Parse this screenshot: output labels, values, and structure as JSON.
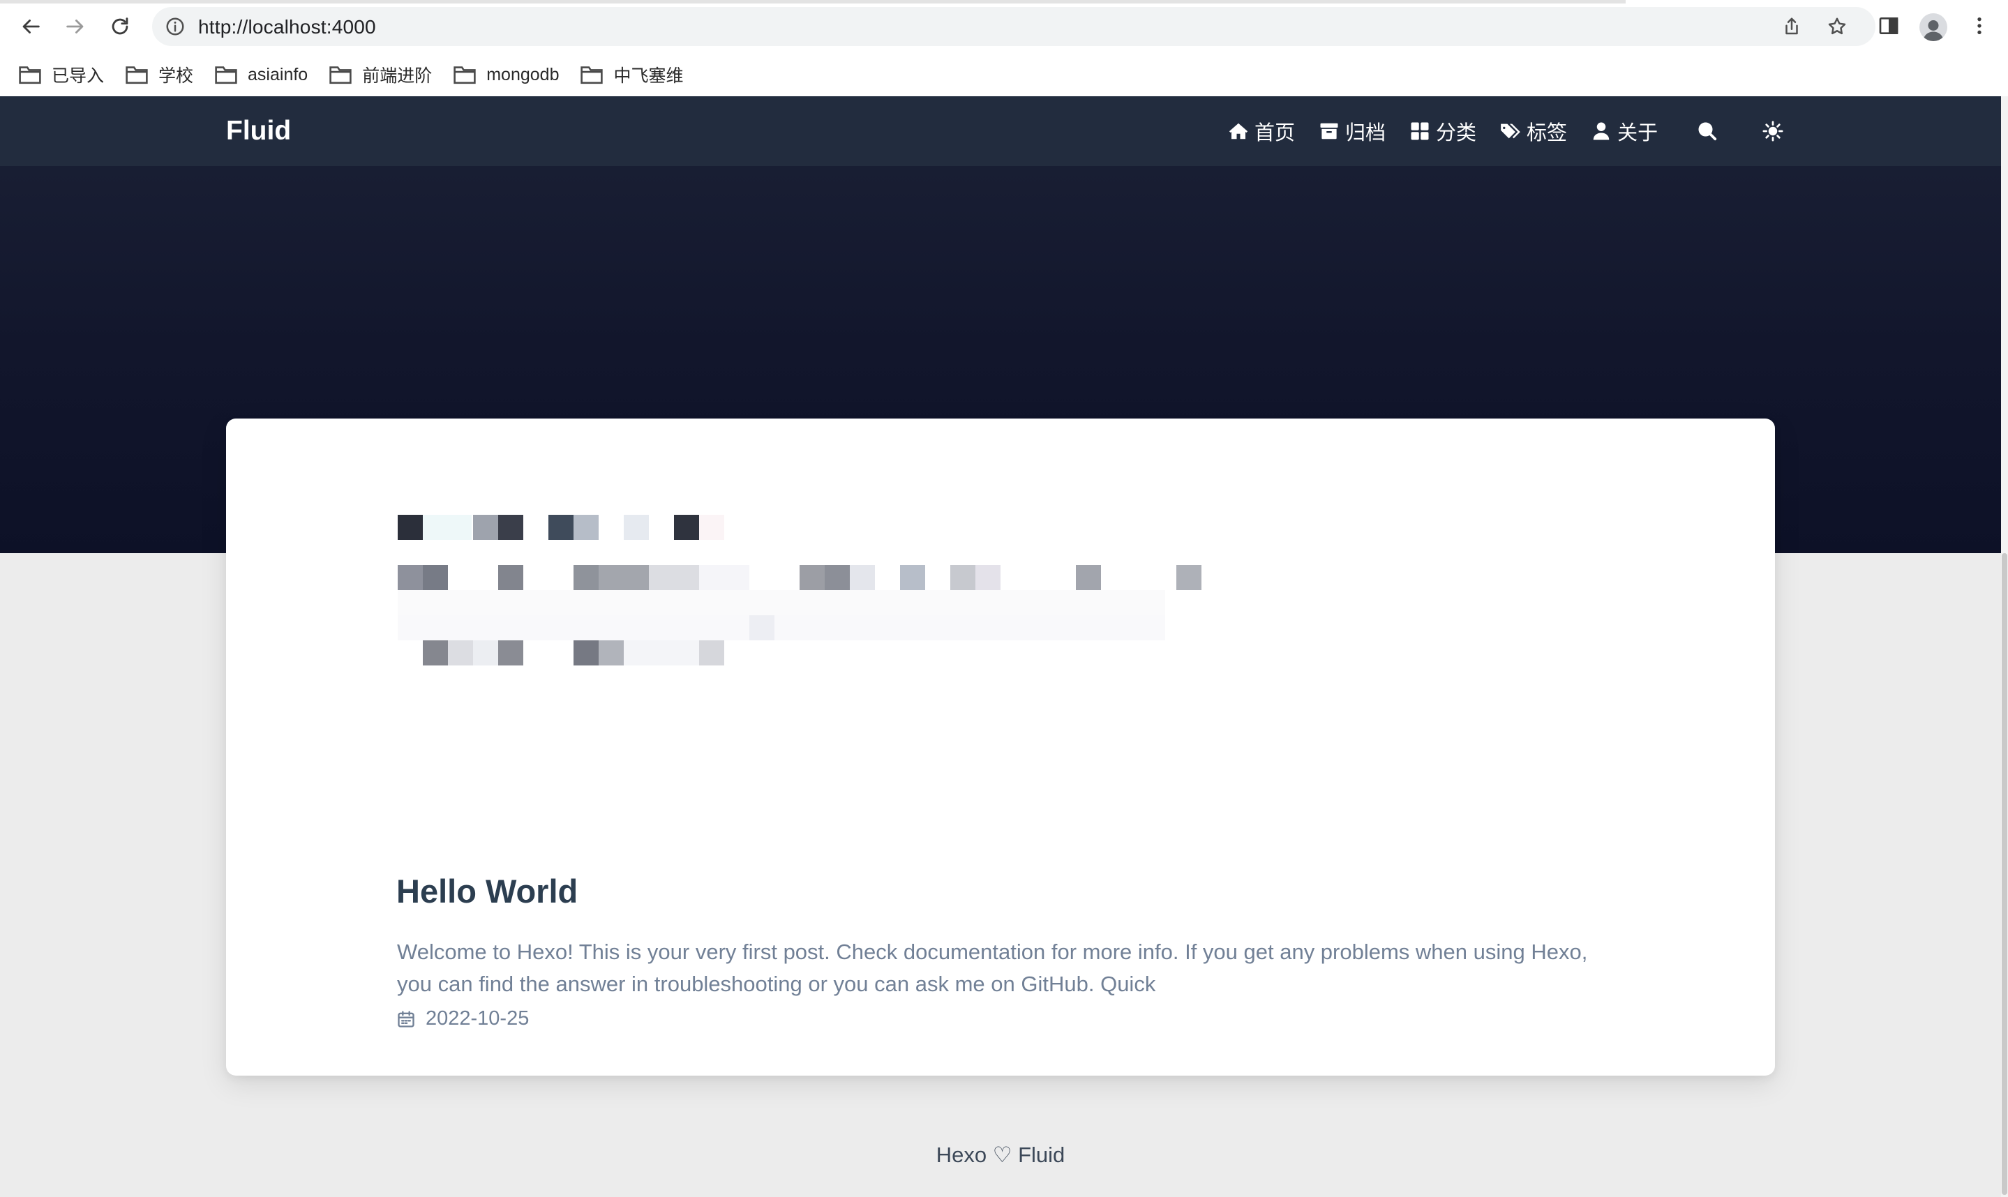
{
  "browser": {
    "url_host": "http://localhost",
    "url_port": ":4000",
    "icons": {
      "back": "arrow-left-icon",
      "forward": "arrow-right-icon",
      "reload": "reload-icon",
      "site_info": "info-icon",
      "share": "share-icon",
      "bookmark_star": "star-icon",
      "side_panel": "side-panel-icon",
      "profile": "profile-icon",
      "menu": "kebab-menu-icon"
    }
  },
  "bookmarks": [
    {
      "label": "已导入"
    },
    {
      "label": "学校"
    },
    {
      "label": "asiainfo"
    },
    {
      "label": "前端进阶"
    },
    {
      "label": "mongodb"
    },
    {
      "label": "中飞塞维"
    }
  ],
  "site": {
    "brand": "Fluid",
    "nav": [
      {
        "label": "首页",
        "icon": "home-icon"
      },
      {
        "label": "归档",
        "icon": "archive-icon"
      },
      {
        "label": "分类",
        "icon": "category-icon"
      },
      {
        "label": "标签",
        "icon": "tags-icon"
      },
      {
        "label": "关于",
        "icon": "user-icon"
      }
    ],
    "search_icon": "search-icon",
    "theme_icon": "sun-icon",
    "colors": {
      "navbar": "#222c3e",
      "banner": "#12162c",
      "title": "#2c3e50",
      "body_text": "#718096"
    }
  },
  "post": {
    "title": "Hello World",
    "excerpt": "Welcome to Hexo! This is your very first post. Check documentation for more info. If you get any problems when using Hexo, you can find the answer in troubleshooting or you can ask me on GitHub. Quick",
    "date": "2022-10-25",
    "date_icon": "calendar-icon"
  },
  "footer": {
    "text": "Hexo ♡ Fluid"
  }
}
